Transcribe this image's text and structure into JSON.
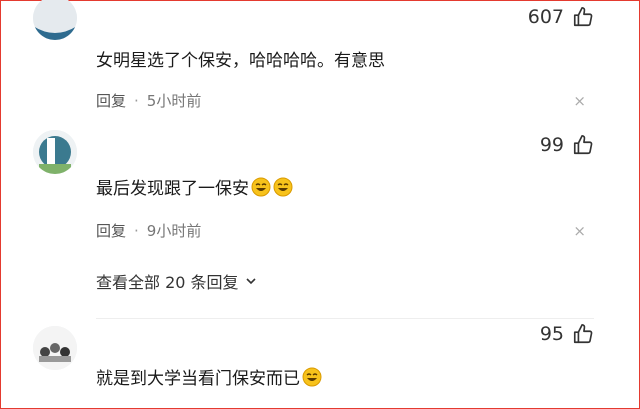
{
  "comments": [
    {
      "likes": "607",
      "text": "女明星选了个保安，哈哈哈哈。有意思",
      "reply_label": "回复",
      "separator": "·",
      "time": "5小时前",
      "close": "×"
    },
    {
      "likes": "99",
      "text": "最后发现跟了一保安",
      "reply_label": "回复",
      "separator": "·",
      "time": "9小时前",
      "close": "×",
      "view_replies": "查看全部 20 条回复"
    },
    {
      "likes": "95",
      "text": "就是到大学当看门保安而已"
    }
  ],
  "icons": {
    "like": "thumbs-up-icon",
    "emoji": "laughing-emoji-icon",
    "expand": "chevron-down-icon"
  },
  "colors": {
    "border": "#e43a2f",
    "emoji": "#f5b300"
  }
}
